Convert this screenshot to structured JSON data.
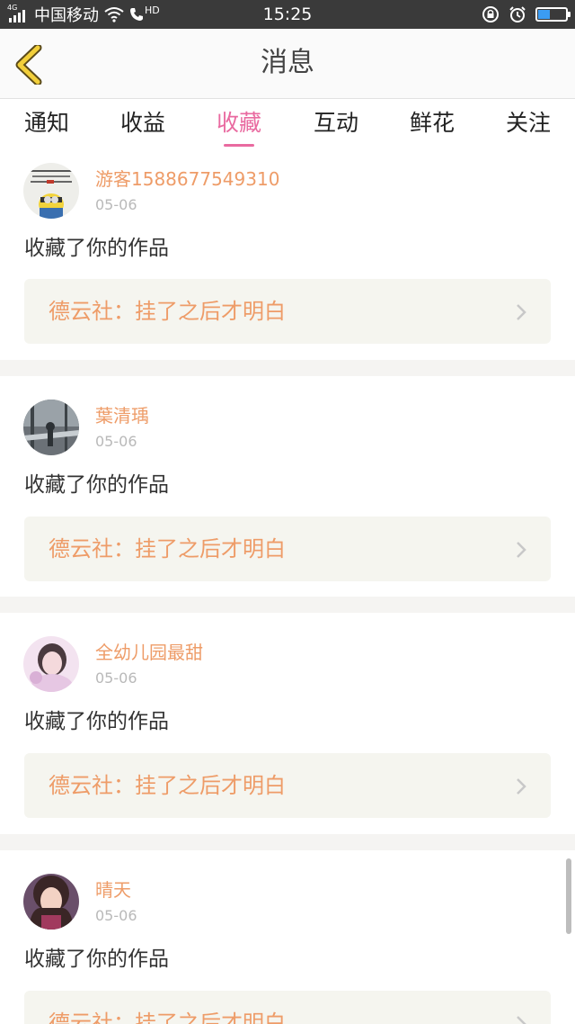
{
  "status_bar": {
    "network": "4G",
    "carrier": "中国移动",
    "call_badge": "HD",
    "time": "15:25",
    "battery_level": 0.42,
    "icons": [
      "signal-icon",
      "wifi-icon",
      "hd-call-icon",
      "rotation-lock-icon",
      "alarm-icon",
      "battery-icon"
    ]
  },
  "header": {
    "title": "消息",
    "back_icon": "back-chevron-icon"
  },
  "tabs": [
    {
      "label": "通知",
      "active": false
    },
    {
      "label": "收益",
      "active": false
    },
    {
      "label": "收藏",
      "active": true
    },
    {
      "label": "互动",
      "active": false
    },
    {
      "label": "鲜花",
      "active": false
    },
    {
      "label": "关注",
      "active": false
    }
  ],
  "accent_color": "#e96aa0",
  "name_color": "#ee9c68",
  "items": [
    {
      "user": "游客1588677549310",
      "date": "05-06",
      "action": "收藏了你的作品",
      "work": "德云社：挂了之后才明白"
    },
    {
      "user": "葉清瑀",
      "date": "05-06",
      "action": "收藏了你的作品",
      "work": "德云社：挂了之后才明白"
    },
    {
      "user": "全幼儿园最甜",
      "date": "05-06",
      "action": "收藏了你的作品",
      "work": "德云社：挂了之后才明白"
    },
    {
      "user": "晴天",
      "date": "05-06",
      "action": "收藏了你的作品",
      "work": "德云社：挂了之后才明白"
    }
  ]
}
